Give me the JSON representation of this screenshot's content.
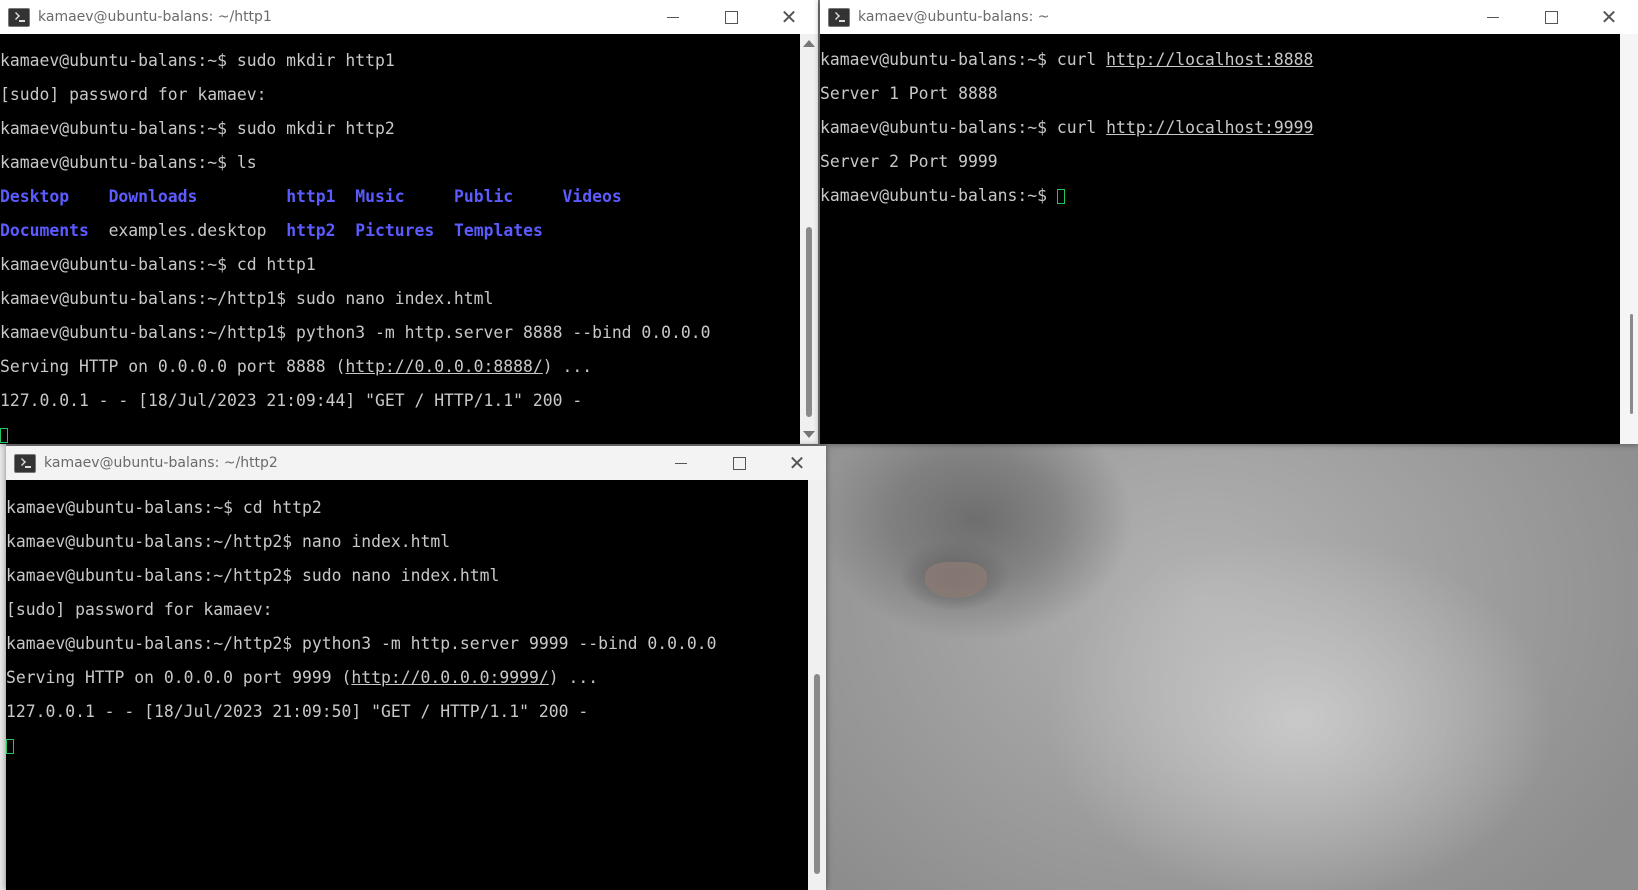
{
  "windows": {
    "http1": {
      "title": "kamaev@ubuntu-balans: ~/http1",
      "lines": {
        "l1": "kamaev@ubuntu-balans:~$ sudo mkdir http1",
        "l2": "[sudo] password for kamaev:",
        "l3": "kamaev@ubuntu-balans:~$ sudo mkdir http2",
        "l4": "kamaev@ubuntu-balans:~$ ls",
        "ls_row1": [
          "Desktop",
          "Downloads",
          "http1",
          "Music",
          "Public",
          "Videos"
        ],
        "ls_row2": [
          "Documents",
          "examples.desktop",
          "http2",
          "Pictures",
          "Templates"
        ],
        "l7": "kamaev@ubuntu-balans:~$ cd http1",
        "l8": "kamaev@ubuntu-balans:~/http1$ sudo nano index.html",
        "l9": "kamaev@ubuntu-balans:~/http1$ python3 -m http.server 8888 --bind 0.0.0.0",
        "l10_pre": "Serving HTTP on 0.0.0.0 port 8888 (",
        "l10_link": "http://0.0.0.0:8888/",
        "l10_post": ") ...",
        "l11": "127.0.0.1 - - [18/Jul/2023 21:09:44] \"GET / HTTP/1.1\" 200 -"
      }
    },
    "home": {
      "title": "kamaev@ubuntu-balans: ~",
      "lines": {
        "l1_pre": "kamaev@ubuntu-balans:~$ curl ",
        "l1_link": "http://localhost:8888",
        "l2": "Server 1 Port 8888",
        "l3_pre": "kamaev@ubuntu-balans:~$ curl ",
        "l3_link": "http://localhost:9999",
        "l4": "Server 2 Port 9999",
        "l5": "kamaev@ubuntu-balans:~$ "
      }
    },
    "http2": {
      "title": "kamaev@ubuntu-balans: ~/http2",
      "lines": {
        "l1": "kamaev@ubuntu-balans:~$ cd http2",
        "l2": "kamaev@ubuntu-balans:~/http2$ nano index.html",
        "l3": "kamaev@ubuntu-balans:~/http2$ sudo nano index.html",
        "l4": "[sudo] password for kamaev:",
        "l5": "kamaev@ubuntu-balans:~/http2$ python3 -m http.server 9999 --bind 0.0.0.0",
        "l6_pre": "Serving HTTP on 0.0.0.0 port 9999 (",
        "l6_link": "http://0.0.0.0:9999/",
        "l6_post": ") ...",
        "l7": "127.0.0.1 - - [18/Jul/2023 21:09:50] \"GET / HTTP/1.1\" 200 -"
      }
    }
  },
  "icons": {
    "app": "terminal-icon",
    "minimize": "minimize-icon",
    "maximize": "maximize-icon",
    "close": "close-icon"
  },
  "colors": {
    "terminal_bg": "#000000",
    "terminal_text": "#c8c8c8",
    "directory": "#5b5bff",
    "cursor": "#22c55e"
  }
}
